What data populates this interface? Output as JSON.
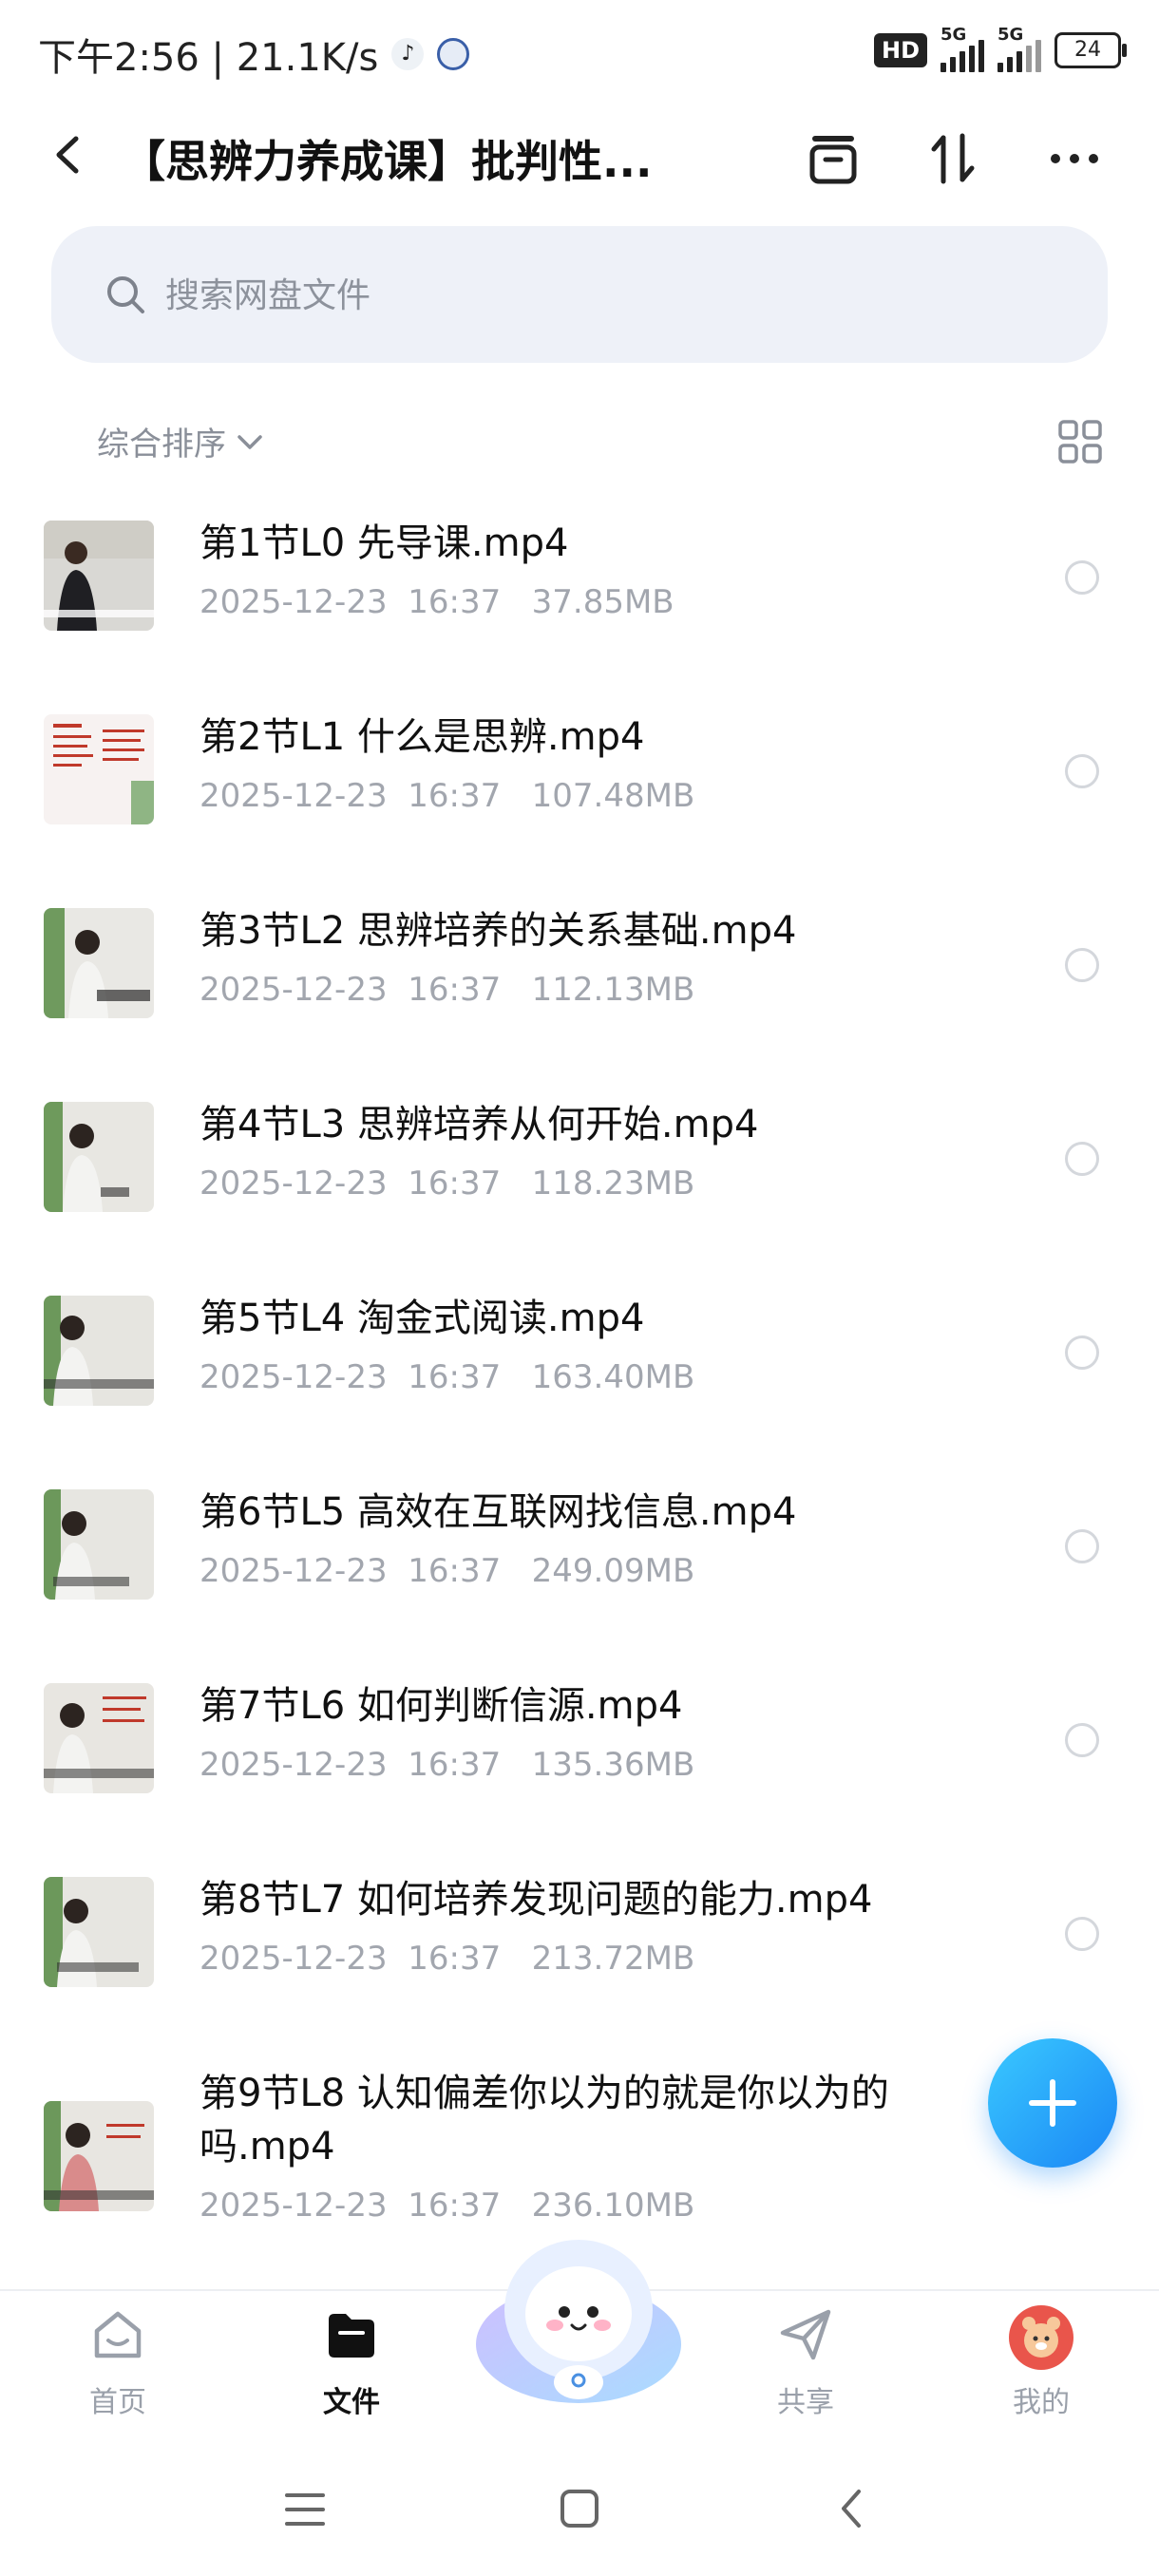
{
  "status_bar": {
    "time_speed": "下午2:56 | 21.1K/s",
    "hd": "HD",
    "network_1": "5G",
    "network_2": "5G",
    "battery": "24"
  },
  "header": {
    "title": "【思辨力养成课】批判性..."
  },
  "search": {
    "placeholder": "搜索网盘文件"
  },
  "sort": {
    "label": "综合排序"
  },
  "files": [
    {
      "name": "第1节L0 先导课.mp4",
      "date": "2025-12-23",
      "time": "16:37",
      "size": "37.85MB"
    },
    {
      "name": "第2节L1 什么是思辨.mp4",
      "date": "2025-12-23",
      "time": "16:37",
      "size": "107.48MB"
    },
    {
      "name": "第3节L2 思辨培养的关系基础.mp4",
      "date": "2025-12-23",
      "time": "16:37",
      "size": "112.13MB"
    },
    {
      "name": "第4节L3 思辨培养从何开始.mp4",
      "date": "2025-12-23",
      "time": "16:37",
      "size": "118.23MB"
    },
    {
      "name": "第5节L4 淘金式阅读.mp4",
      "date": "2025-12-23",
      "time": "16:37",
      "size": "163.40MB"
    },
    {
      "name": "第6节L5 高效在互联网找信息.mp4",
      "date": "2025-12-23",
      "time": "16:37",
      "size": "249.09MB"
    },
    {
      "name": "第7节L6 如何判断信源.mp4",
      "date": "2025-12-23",
      "time": "16:37",
      "size": "135.36MB"
    },
    {
      "name": "第8节L7 如何培养发现问题的能力.mp4",
      "date": "2025-12-23",
      "time": "16:37",
      "size": "213.72MB"
    },
    {
      "name": "第9节L8 认知偏差你以为的就是你以为的吗.mp4",
      "date": "2025-12-23",
      "time": "16:37",
      "size": "236.10MB"
    }
  ],
  "nav": {
    "home": "首页",
    "files": "文件",
    "share": "共享",
    "mine": "我的"
  },
  "colors": {
    "accent": "#1a86f5",
    "meta_text": "#a2a6ae",
    "search_bg": "#eef1f8"
  }
}
